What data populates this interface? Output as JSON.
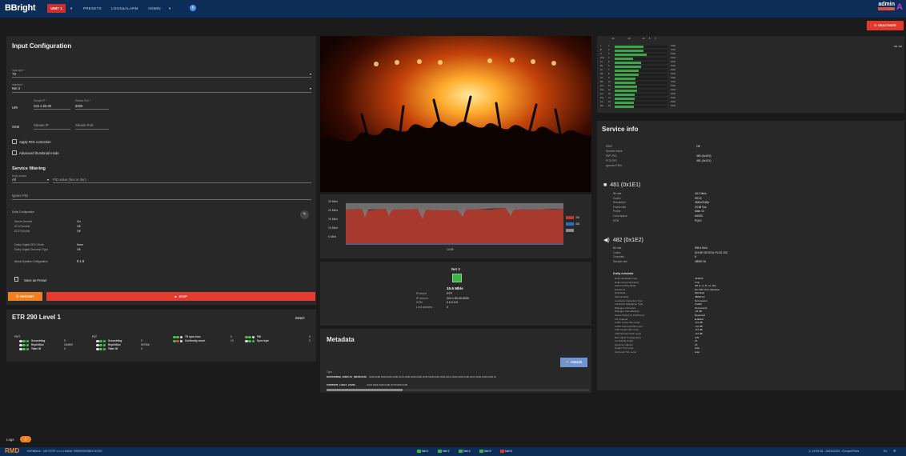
{
  "topbar": {
    "logo": "BBright",
    "nav": {
      "active": "UNIT 1",
      "items": [
        "PRESETS",
        "LOGS&ALARM",
        "ADMIN"
      ]
    },
    "user": {
      "name": "admin",
      "role": "admin"
    }
  },
  "deactivate": "DEACTIVATE",
  "input": {
    "title": "Input Configuration",
    "input_type_label": "Input type *",
    "input_type": "TS",
    "interface_label": "Interface *",
    "interface": "Net 3",
    "uri_label": "URI",
    "stream_ip_label": "Stream IP *",
    "stream_ip": "224.1.50.90",
    "stream_port_label": "Stream Port *",
    "stream_port": "5000",
    "ssm_label": "SSM",
    "ssm_ip_ph": "Stream IP",
    "ssm_port_ph": "Stream Port",
    "apply_fec": "Apply FEC correction",
    "adv_thumb": "Advanced thumbnail mode",
    "filter_title": "Service filtering",
    "keep_label": "Keep service",
    "keep_value": "All",
    "pid_ph": "PID value (hex or dec)",
    "ignore_pid": "Ignore PID",
    "dolby_title": "Dolby Configuration",
    "dolby": [
      [
        "Atmos Decode",
        "On"
      ],
      [
        "AC4 Decode",
        "Off"
      ],
      [
        "ED2 Decode",
        "Off"
      ]
    ],
    "dolby2": [
      [
        "Dolby Digital DRC Mode",
        "None"
      ],
      [
        "Dolby Digital Downmix Type",
        "Off"
      ]
    ],
    "speaker_label": "Atmos Speaker Configuration",
    "speaker": "9.1.6",
    "save_preset": "Save as Preset",
    "restart": "RESTART",
    "stop": "STOP"
  },
  "etr": {
    "title": "ETR 290 Level 1",
    "reset": "RESET",
    "pmt": "PMT",
    "pat": "PAT",
    "g1": [
      [
        "Scrambling",
        "0"
      ],
      [
        "Repetition",
        "2A0490"
      ],
      [
        "Table ID",
        "0"
      ]
    ],
    "g2": [
      [
        "Scrambling",
        "0"
      ],
      [
        "Repetition",
        "5479b6"
      ],
      [
        "Table ID",
        "0"
      ]
    ],
    "g3": [
      [
        "TS sync loss",
        "0"
      ],
      [
        "Continuity count",
        "13"
      ]
    ],
    "g4": [
      [
        "PID",
        "0"
      ],
      [
        "Sync byte",
        "0"
      ]
    ]
  },
  "bitrate_chart": {
    "ticks": [
      "25 Mb/s",
      "20 Mb/s",
      "15 Mb/s",
      "10 Mb/s",
      "5 Mb/s"
    ],
    "time": "14:59",
    "legend": [
      "481",
      "482",
      ""
    ]
  },
  "chart_data": {
    "type": "area",
    "title": "",
    "xlabel": "",
    "ylabel": "",
    "ylim": [
      0,
      25
    ],
    "x": [
      "14:59"
    ],
    "series": [
      {
        "name": "481",
        "values": [
          18.2
        ]
      },
      {
        "name": "482",
        "values": [
          0.6
        ]
      }
    ]
  },
  "net": {
    "title": "Net 3",
    "rate": "15.6 Mb/s",
    "rows": [
      [
        "Protocol",
        "RTP"
      ],
      [
        "IP source",
        "224.1.50.90:5000"
      ],
      [
        "SSM",
        "0.0.0.0:0"
      ],
      [
        "Lost packets",
        "0"
      ]
    ]
  },
  "metadata": {
    "title": "Metadata",
    "freeze": "FREEZE",
    "type_label": "Type",
    "k1": "MASTERING_DISPLAY_METADATA",
    "v1": "0x00 0x84 0x00 0x00 0x00 0xC3 0x00 0x00 0x00 0x35 0x00 0x00 0x00 0xC3 0x00 0x00 0x00 0xC3 0x00 0x00 0x00 0x",
    "k2": "CONTENT_LIGHT_LEVEL",
    "v2": "0x04 0x84 0x00 0x00 0x78 0x00 0x00"
  },
  "meters": {
    "header": [
      "-40",
      "-20",
      "-10",
      "-5",
      "0"
    ],
    "rows": [
      "L",
      "R",
      "C",
      "LFE",
      "Ls",
      "Rs",
      "Lb",
      "Rb",
      "Ltf",
      "Rtf",
      "Ltm",
      "Rtm",
      "Lrs",
      "Rrs",
      "Lw",
      "Rw"
    ],
    "pid": "PID: 482",
    "fill": [
      0.55,
      0.55,
      0.6,
      0.35,
      0.5,
      0.5,
      0.45,
      0.45,
      0.4,
      0.4,
      0.42,
      0.42,
      0.38,
      0.38,
      0.36,
      0.36
    ],
    "tag": "PCM"
  },
  "service": {
    "title": "Service info",
    "rows": [
      [
        "SSID",
        "Off"
      ],
      [
        "Service name",
        "-"
      ],
      [
        "PMT PID",
        "480 (0x1E0)"
      ],
      [
        "PCR PID",
        "481 (0x1E1)"
      ],
      [
        "Ignored PIDs",
        ""
      ]
    ],
    "video_title": "481 (0x1E1)",
    "video": [
      [
        "Bit rate",
        "18.2 Mb/s"
      ],
      [
        "Codec",
        "HEVC"
      ],
      [
        "Resolution",
        "3840x2160p"
      ],
      [
        "Frame rate",
        "23.98 Fps"
      ],
      [
        "Profile",
        "Main 10"
      ],
      [
        "Color space",
        "bt2020"
      ],
      [
        "HDR",
        "PQ10"
      ]
    ],
    "audio_title": "482 (0x1E2)",
    "audio": [
      [
        "Bit rate",
        "595.4 Kb/s"
      ],
      [
        "Codec",
        "DOLBY DIGITAL PLUS JOC"
      ],
      [
        "Channels",
        "6"
      ],
      [
        "Sample rate",
        "48000 Hz"
      ]
    ],
    "dolby_meta_title": "Dolby metadata",
    "dolby_meta": [
      [
        "Dolby Metadata Type",
        "ATMOS"
      ],
      [
        "Dolby Atmos Presence",
        "True"
      ],
      [
        "Audio Coding Mode",
        "3/2 (L, C, R, Ls, Rs)"
      ],
      [
        "Dol Errors",
        "No CRC error detected"
      ],
      [
        "Data Rate",
        "640 kbps"
      ],
      [
        "Sample Rate",
        "48000 Hz"
      ],
      [
        "Loudness Correction Type",
        "Not present"
      ],
      [
        "Loudness Regulation Type",
        "Invalid"
      ],
      [
        "Dialogue Corrected",
        "Not present"
      ],
      [
        "Dialogue Normalization",
        "-24 dB"
      ],
      [
        "Stereo Downmix Preference",
        "Reserved"
      ],
      [
        "Lfe Channel",
        "Enabled"
      ],
      [
        "Lo/Ro Center Mix Level",
        "-3.0 dB"
      ],
      [
        "Lo/Ro Surround Mix Level",
        "-3.0 dB"
      ],
      [
        "Lt/Rt Center Mix Level",
        "-3.0 dB"
      ],
      [
        "Lt/Rt Surround Mix Level",
        "-3.0 dB"
      ],
      [
        "Bed object Configuration",
        "LFE"
      ],
      [
        "Complexity Index",
        "16"
      ],
      [
        "Dynamic Objects",
        "15"
      ],
      [
        "Height Trim Level",
        "Auto"
      ],
      [
        "Surround Trim Level",
        "Auto"
      ]
    ]
  },
  "footer": {
    "logs": "Logs",
    "badge": "0",
    "rmd": "RMD",
    "platform": "MxPlatform - NO STOP  x.x.x.x build#: 3999000000891731000",
    "nets": [
      "Net 1",
      "Net 2",
      "Net 4",
      "Net 5",
      "Net 6"
    ],
    "clock": "14:59:28 - 24/02/2025 - Europe/Paris",
    "lang": "En"
  }
}
